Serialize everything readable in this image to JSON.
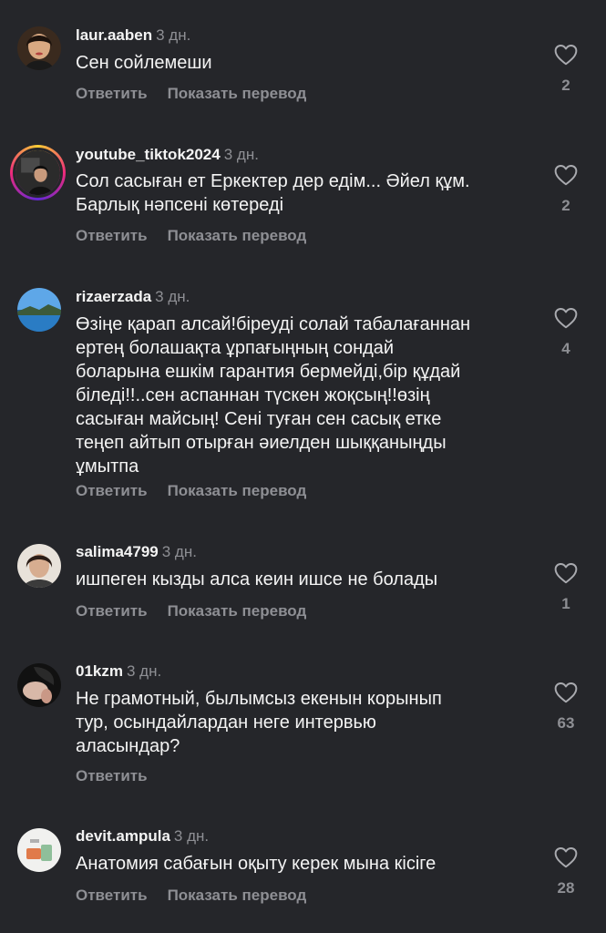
{
  "comments": [
    {
      "username": "laur.aaben",
      "time": "3 дн.",
      "text": "Сен сойлемеши",
      "reply": "Ответить",
      "translate": "Показать перевод",
      "likes": "2"
    },
    {
      "username": "youtube_tiktok2024",
      "time": "3 дн.",
      "text": "Сол сасыған ет Еркектер дер едім... Әйел құм.\nБарлық нәпсені көтереді",
      "reply": "Ответить",
      "translate": "Показать перевод",
      "likes": "2"
    },
    {
      "username": "rizaerzada",
      "time": "3 дн.",
      "text": "Өзіңе қарап алсай!біреуді солай табалағаннан\nертең болашақта ұрпағыңның сондай\nболарына ешкім гарантия бермейді,бір құдай\nбіледі!!..сен аспаннан түскен жоқсың!!өзің\nсасыған майсың!  Сені туған сен  сасық етке\nтеңеп айтып отырған әиелден шыққаныңды\nұмытпа",
      "reply": "Ответить",
      "translate": "Показать перевод",
      "likes": "4"
    },
    {
      "username": "salima4799",
      "time": "3 дн.",
      "text": "ишпеген кызды алса кеин ишсе не болады",
      "reply": "Ответить",
      "translate": "Показать перевод",
      "likes": "1"
    },
    {
      "username": "01kzm",
      "time": "3 дн.",
      "text": "Не грамотный, былымсыз екенын корынып\nтур, осындайлардан неге интервью\naласындар?",
      "reply": "Ответить",
      "likes": "63"
    },
    {
      "username": "devit.ampula",
      "time": "3 дн.",
      "text": "Анатомия сабағын оқыту керек мына кісіге",
      "reply": "Ответить",
      "translate": "Показать перевод",
      "likes": "28"
    }
  ],
  "icons": {
    "like": "heart-outline-icon"
  },
  "colors": {
    "background": "#25262a",
    "text": "#f4f4f4",
    "muted": "#8e8f94"
  }
}
